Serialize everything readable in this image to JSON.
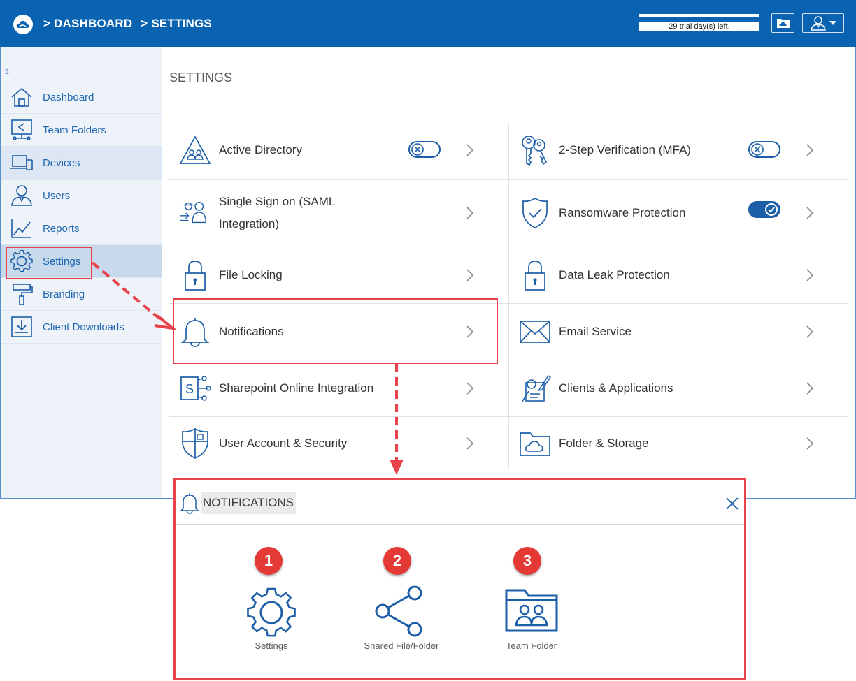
{
  "topbar": {
    "breadcrumb": [
      "> DASHBOARD",
      "> SETTINGS"
    ],
    "trial_text": "29 trial day(s) left."
  },
  "sidebar": {
    "items": [
      {
        "label": "Dashboard"
      },
      {
        "label": "Team Folders"
      },
      {
        "label": "Devices"
      },
      {
        "label": "Users"
      },
      {
        "label": "Reports"
      },
      {
        "label": "Settings"
      },
      {
        "label": "Branding"
      },
      {
        "label": "Client Downloads"
      }
    ]
  },
  "main": {
    "title": "SETTINGS",
    "left": [
      {
        "label": "Active Directory",
        "toggle": "off"
      },
      {
        "label_line1": "Single Sign on (SAML",
        "label_line2": "Integration)"
      },
      {
        "label": "File Locking"
      },
      {
        "label": "Notifications"
      },
      {
        "label": "Sharepoint Online Integration"
      },
      {
        "label": "User Account & Security"
      }
    ],
    "right": [
      {
        "label": "2-Step Verification (MFA)",
        "toggle": "off"
      },
      {
        "label": "Ransomware Protection",
        "toggle": "on"
      },
      {
        "label": "Data Leak Protection"
      },
      {
        "label": "Email Service"
      },
      {
        "label": "Clients & Applications"
      },
      {
        "label": "Folder & Storage"
      }
    ]
  },
  "notifications_panel": {
    "title": "NOTIFICATIONS",
    "items": [
      {
        "badge": "1",
        "label": "Settings",
        "icon": "gear-icon"
      },
      {
        "badge": "2",
        "label": "Shared File/Folder",
        "icon": "share-icon"
      },
      {
        "badge": "3",
        "label": "Team Folder",
        "icon": "team-folder-icon"
      }
    ]
  },
  "colors": {
    "brand_blue": "#0a63b0",
    "icon_blue": "#1d5ea8",
    "highlight_red": "#e8434b",
    "badge_red": "#e53935"
  }
}
